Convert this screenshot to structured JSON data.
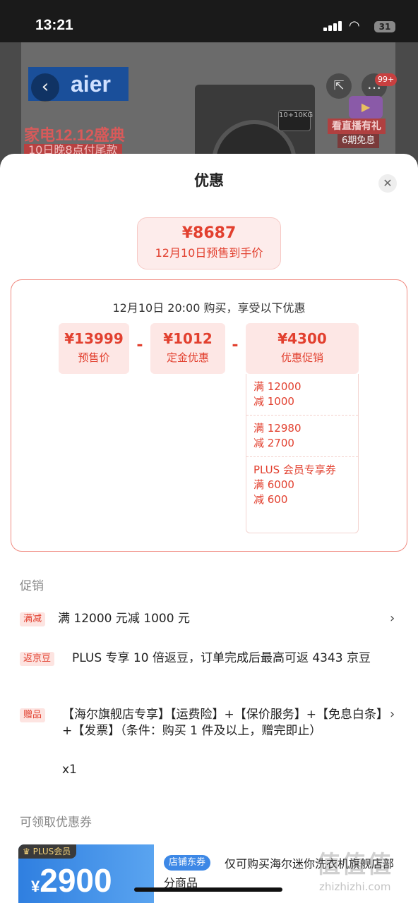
{
  "status_bar": {
    "time": "13:21",
    "battery": "31"
  },
  "background": {
    "brand": "aier",
    "promo_title": "家电12.12盛典",
    "promo_sub": "10日晚8点付尾款",
    "washer_badge": "10+10KG",
    "message_badge": "99+",
    "live_title": "看直播有礼",
    "live_sub": "6期免息"
  },
  "sheet": {
    "title": "优惠",
    "final_price": {
      "amount": "¥8687",
      "note": "12月10日预售到手价"
    },
    "breakdown": {
      "heading": "12月10日 20:00 购买，享受以下优惠",
      "presale": {
        "amount": "¥13999",
        "label": "预售价"
      },
      "deposit": {
        "amount": "¥1012",
        "label": "定金优惠"
      },
      "promotion": {
        "amount": "¥4300",
        "label": "优惠促销"
      },
      "minus": "-",
      "conditions": [
        {
          "lines": [
            "满 12000",
            "减 1000"
          ]
        },
        {
          "lines": [
            "满 12980",
            "减 2700"
          ]
        },
        {
          "lines": [
            "PLUS 会员专享券",
            "满 6000",
            "减 600"
          ]
        }
      ]
    },
    "promotions": {
      "label": "促销",
      "items": [
        {
          "tag": "满减",
          "text": "满 12000 元减 1000 元",
          "chevron": "›"
        },
        {
          "tag": "返京豆",
          "text": "PLUS 专享 10 倍返豆，订单完成后最高可返 4343 京豆"
        },
        {
          "tag": "赠品",
          "text": "【海尔旗舰店专享】【运费险】+【保价服务】+【免息白条】+【发票】（条件：购买 1 件及以上，赠完即止）",
          "qty": "x1",
          "chevron": "›"
        }
      ]
    },
    "coupons": {
      "label": "可领取优惠券",
      "items": [
        {
          "badge": "PLUS会员",
          "currency": "¥",
          "amount": "2900",
          "tag": "店铺东券",
          "desc": "仅可购买海尔迷你洗衣机旗舰店部分商品"
        }
      ]
    }
  },
  "watermark": {
    "text": "值值值",
    "url": "zhizhizhi.com"
  }
}
